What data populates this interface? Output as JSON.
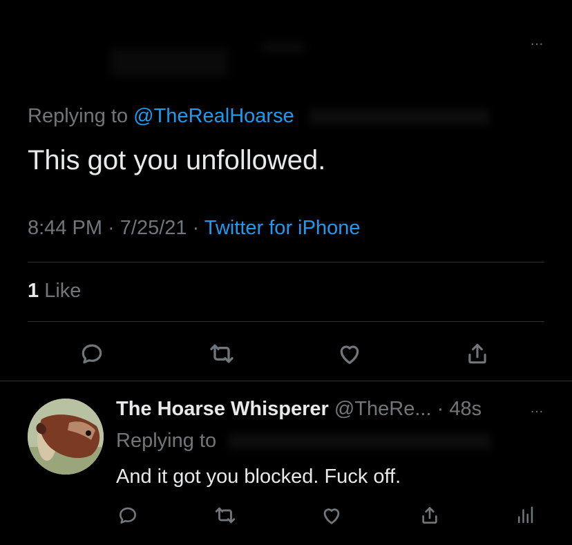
{
  "header": {
    "more_icon": "…"
  },
  "tweet": {
    "replying_prefix": "Replying to",
    "replying_handle": "@TheRealHoarse",
    "text": "This got you unfollowed.",
    "time": "8:44 PM",
    "date": "7/25/21",
    "source": "Twitter for iPhone",
    "sep": " · ",
    "like_count": "1",
    "like_label": "Like"
  },
  "actions": [
    "reply-icon",
    "retweet-icon",
    "like-icon",
    "share-icon"
  ],
  "reply": {
    "name": "The Hoarse Whisperer",
    "handle": "@TheRe...",
    "time": "48s",
    "sep": " · ",
    "replying_prefix": "Replying to",
    "text": "And it got you blocked. Fuck off.",
    "more_icon": "…",
    "actions": [
      "reply-icon",
      "retweet-icon",
      "like-icon",
      "share-icon",
      "analytics-icon"
    ]
  },
  "colors": {
    "accent": "#1d9bf0",
    "muted": "#71767b",
    "text": "#e7e9ea",
    "background": "#000000",
    "divider": "#2f3336"
  }
}
